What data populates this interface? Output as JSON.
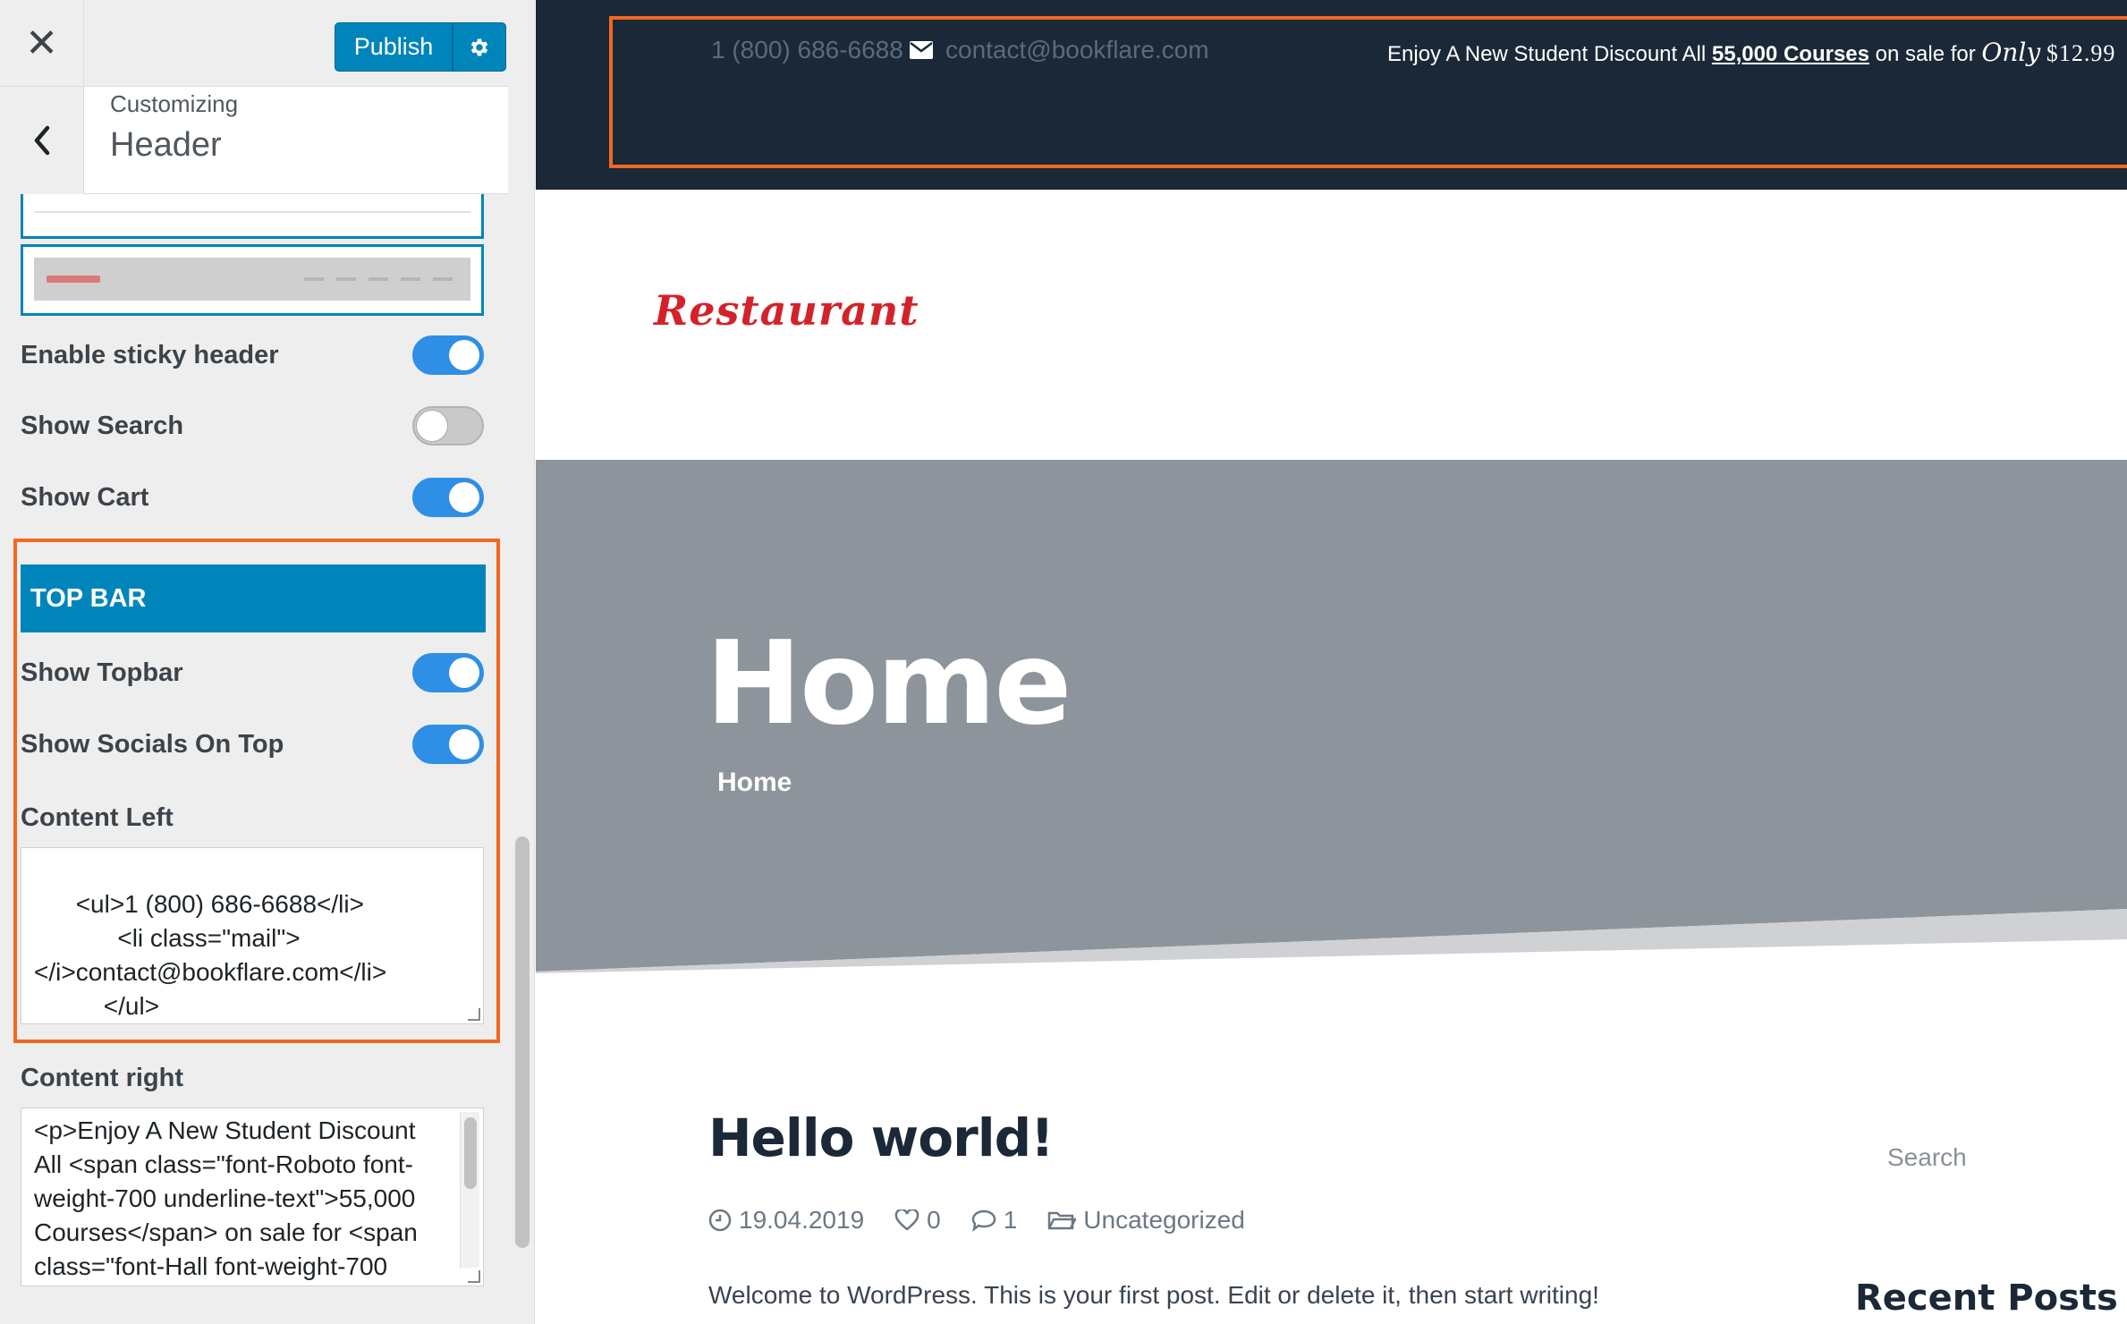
{
  "sidebar": {
    "close_glyph": "✕",
    "publish_label": "Publish",
    "customizing_label": "Customizing",
    "section_title": "Header",
    "toggles": [
      {
        "label": "Enable sticky header",
        "on": true
      },
      {
        "label": "Show Search",
        "on": false
      },
      {
        "label": "Show Cart",
        "on": true
      }
    ],
    "topbar_heading": "TOP BAR",
    "topbar_toggles": [
      {
        "label": "Show Topbar",
        "on": true
      },
      {
        "label": "Show Socials On Top",
        "on": true
      }
    ],
    "content_left_label": "Content Left",
    "content_left_value": "<ul>1 (800) 686-6688</li>\n            <li class=\"mail\">\n</i>contact@bookflare.com</li>\n          </ul>",
    "content_right_label": "Content right",
    "content_right_value": "<p>Enjoy A New Student Discount All <span class=\"font-Roboto font-weight-700 underline-text\">55,000 Courses</span> on sale for <span class=\"font-Hall font-weight-700"
  },
  "preview": {
    "topbar": {
      "phone": "1 (800) 686-6688",
      "email": "contact@bookflare.com",
      "right_pre": "Enjoy A New Student Discount All ",
      "right_link": "55,000 Courses",
      "right_mid": " on sale for ",
      "right_only": "Only",
      "right_price": "$12.99"
    },
    "logo_text": "Restaurant",
    "hero_title": "Home",
    "hero_breadcrumb": "Home",
    "post": {
      "title": "Hello world!",
      "date": "19.04.2019",
      "likes": "0",
      "comments": "1",
      "category": "Uncategorized",
      "excerpt": "Welcome to WordPress. This is your first post. Edit or delete it, then start writing!"
    },
    "widgets": {
      "search_label": "Search",
      "recent_posts_title": "Recent Posts"
    }
  },
  "colors": {
    "accent": "#0085ba",
    "highlight": "#f26722",
    "toggle_on": "#2f8ee6",
    "topbar_bg": "#1b2837",
    "hero_bg": "#8e949b",
    "logo": "#d3232a"
  }
}
